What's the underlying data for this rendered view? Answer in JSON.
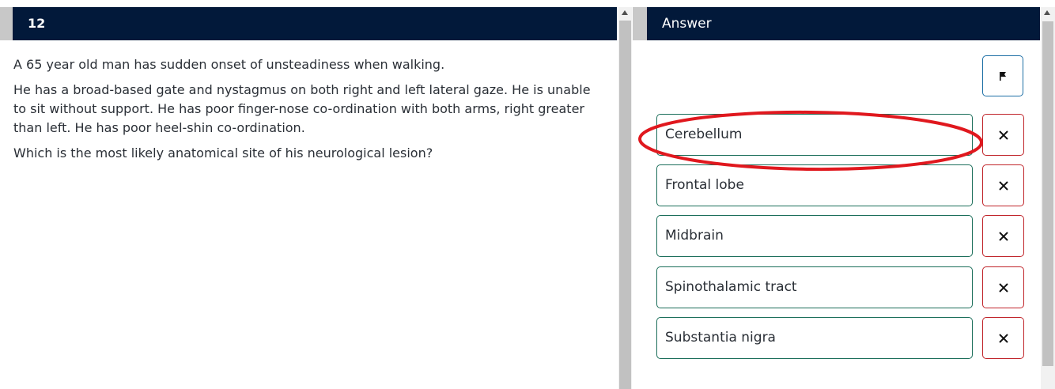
{
  "question": {
    "number": "12",
    "paragraphs": [
      "A 65 year old man has sudden onset of unsteadiness when walking.",
      "He has a broad-based gate and nystagmus on both right and left lateral gaze. He is unable to sit without support. He has poor finger-nose co-ordination with both arms, right greater than left. He has poor heel-shin co-ordination.",
      "Which is the most likely anatomical site of his neurological lesion?"
    ]
  },
  "answer_panel": {
    "title": "Answer",
    "flag_icon": "flag-icon",
    "options": [
      {
        "label": "Cerebellum",
        "remove_icon": "close-icon"
      },
      {
        "label": "Frontal lobe",
        "remove_icon": "close-icon"
      },
      {
        "label": "Midbrain",
        "remove_icon": "close-icon"
      },
      {
        "label": "Spinothalamic tract",
        "remove_icon": "close-icon"
      },
      {
        "label": "Substantia nigra",
        "remove_icon": "close-icon"
      }
    ],
    "highlighted_option": "Cerebellum"
  },
  "colors": {
    "header_bg": "#02193a",
    "option_border": "#1b6e5a",
    "remove_border": "#c0252b",
    "flag_border": "#1d6fa5",
    "annotation": "#e0181e"
  }
}
